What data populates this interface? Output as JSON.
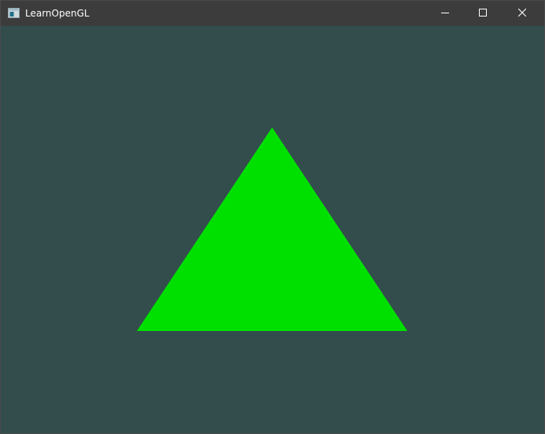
{
  "window": {
    "title": "LearnOpenGL",
    "icon": "opengl-window-icon",
    "controls": {
      "minimize_icon": "minimize-icon",
      "maximize_icon": "maximize-icon",
      "close_icon": "close-icon"
    }
  },
  "scene": {
    "clear_color": "#334d4d",
    "triangle_color": "#00e000"
  }
}
